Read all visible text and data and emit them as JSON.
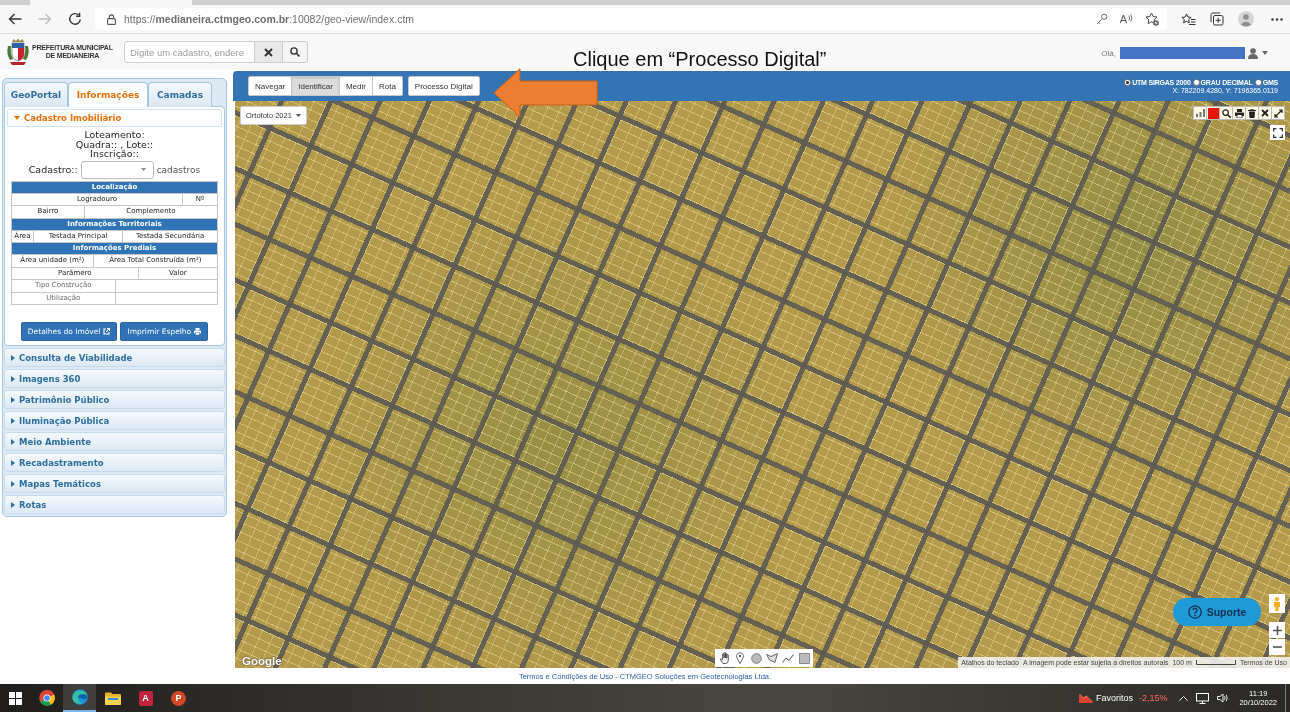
{
  "browser": {
    "nav": [
      {
        "kind": "back",
        "disabled": false
      },
      {
        "kind": "forward",
        "disabled": true
      },
      {
        "kind": "reload",
        "disabled": false
      }
    ],
    "url": "https://**medianeira.ctmgeo.com.br**:10082/geo-view/index.ctm",
    "read_aloud": "A"
  },
  "header": {
    "logo_lines": [
      "PREFEITURA MUNICIPAL",
      "DE MEDIANEIRA"
    ],
    "search": {
      "placeholder": "Digite um cadastro, endere"
    },
    "greeting": "Olá,"
  },
  "annotation": {
    "text": "Clique em “Processo Digital”"
  },
  "sidebar": {
    "tabs": [
      {
        "label": "GeoPortal",
        "selected": false
      },
      {
        "label": "Informações",
        "selected": true
      },
      {
        "label": "Camadas",
        "selected": false
      }
    ],
    "sections": [
      {
        "title": "Cadastro Imobiliário",
        "expanded": true,
        "content": {
          "lines": [
            "Loteamento:",
            "Quadra:: , Lote::",
            "Inscrição::"
          ],
          "select": {
            "label": "Cadastro::",
            "suffix": "cadastros"
          },
          "table": [
            {
              "kind": "header",
              "cells": [
                "Localização"
              ]
            },
            {
              "kind": "row",
              "cells": [
                "Logradouro",
                "Nº"
              ]
            },
            {
              "kind": "row",
              "cells": [
                "Bairro",
                "Complemento"
              ]
            },
            {
              "kind": "header",
              "cells": [
                "Informações Territoriais"
              ]
            },
            {
              "kind": "row",
              "cells": [
                "Área",
                "Testada Principal",
                "Testada Secundária"
              ]
            },
            {
              "kind": "header",
              "cells": [
                "Informações Prediais"
              ]
            },
            {
              "kind": "row",
              "cells": [
                "Área unidade (m²)",
                "Área Total Construída (m²)"
              ]
            },
            {
              "kind": "row",
              "cells": [
                "Parâmero",
                "Valor"
              ]
            },
            {
              "kind": "param",
              "cells": [
                "Tipo Construção"
              ]
            },
            {
              "kind": "param",
              "cells": [
                "Utilização"
              ]
            }
          ],
          "buttons": [
            {
              "kind": "open",
              "label": "Detalhes do Imóvel"
            },
            {
              "kind": "print",
              "label": "Imprimir Espelho"
            }
          ]
        }
      },
      {
        "title": "Consulta de Viabilidade",
        "expanded": false
      },
      {
        "title": "Imagens 360",
        "expanded": false
      },
      {
        "title": "Patrimônio Público",
        "expanded": false
      },
      {
        "title": "Iluminação Pública",
        "expanded": false
      },
      {
        "title": "Meio Ambiente",
        "expanded": false
      },
      {
        "title": "Recadastramento",
        "expanded": false
      },
      {
        "title": "Mapas Temáticos",
        "expanded": false
      },
      {
        "title": "Rotas",
        "expanded": false
      }
    ]
  },
  "map": {
    "toolbar": {
      "modes": [
        {
          "label": "Navegar",
          "selected": false
        },
        {
          "label": "Identificar",
          "selected": true
        },
        {
          "label": "Medir",
          "selected": false
        },
        {
          "label": "Rota",
          "selected": false
        }
      ],
      "action": "Processo Digital"
    },
    "projection": {
      "options": [
        {
          "label": "UTM SIRGAS 2000",
          "selected": true
        },
        {
          "label": "GRAU DECIMAL",
          "selected": false
        },
        {
          "label": "GMS",
          "selected": false
        }
      ],
      "reading": "X: 782209.4280, Y: 7196365.0119"
    },
    "layer": "Ortofoto 2021",
    "support": "Suporte",
    "provider": "Google",
    "attribution": {
      "shortcuts": "Atalhos do teclado",
      "rights": "A imagem pode estar sujeita a direitos autorais",
      "scale": "100 m",
      "terms": "Termos de Uso"
    }
  },
  "footer": {
    "text": "Termos e Condições de Uso - CTMGEO Soluções em Geotecnologias Ltda."
  },
  "taskbar": {
    "apps": [
      {
        "kind": "start",
        "selected": false
      },
      {
        "kind": "ring",
        "selected": false
      },
      {
        "kind": "swirl",
        "selected": true
      },
      {
        "kind": "folder",
        "selected": false
      },
      {
        "kind": "tile",
        "letter": "A",
        "selected": false
      },
      {
        "kind": "disc",
        "letter": "P",
        "selected": false
      }
    ],
    "tray": {
      "label": "Favoritos",
      "change": "-2,15%",
      "time": "11:19",
      "date": "20/10/2022"
    }
  }
}
